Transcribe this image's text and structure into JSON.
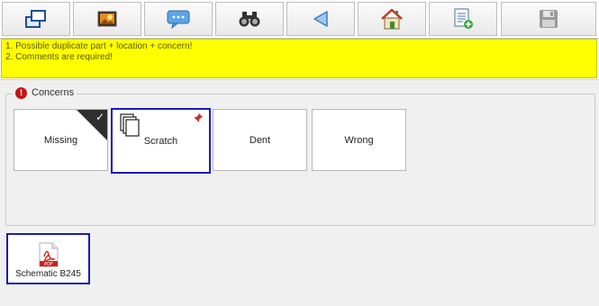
{
  "toolbar": {
    "buttons": [
      {
        "icon": "windows-icon"
      },
      {
        "icon": "image-icon"
      },
      {
        "icon": "comment-bubble-icon"
      },
      {
        "icon": "binoculars-icon"
      },
      {
        "icon": "back-arrow-icon"
      },
      {
        "icon": "home-icon"
      },
      {
        "icon": "add-document-icon"
      },
      {
        "icon": "save-disk-icon"
      }
    ]
  },
  "alert": {
    "color": "#ffff00",
    "lines": [
      "1. Possible duplicate part + location + concern!",
      "2. Comments are required!"
    ]
  },
  "concerns": {
    "legend": "Concerns",
    "warn_glyph": "!",
    "check_glyph": "✓",
    "items": [
      {
        "label": "Missing",
        "checked": true
      },
      {
        "label": "Scratch",
        "selected": true,
        "pinned": true
      },
      {
        "label": "Dent"
      },
      {
        "label": "Wrong"
      }
    ]
  },
  "attachment": {
    "label": "Schematic B245",
    "pdf_text": "PDF"
  },
  "colors": {
    "selection_border": "#1a1ab8",
    "warning_red": "#c41616"
  }
}
